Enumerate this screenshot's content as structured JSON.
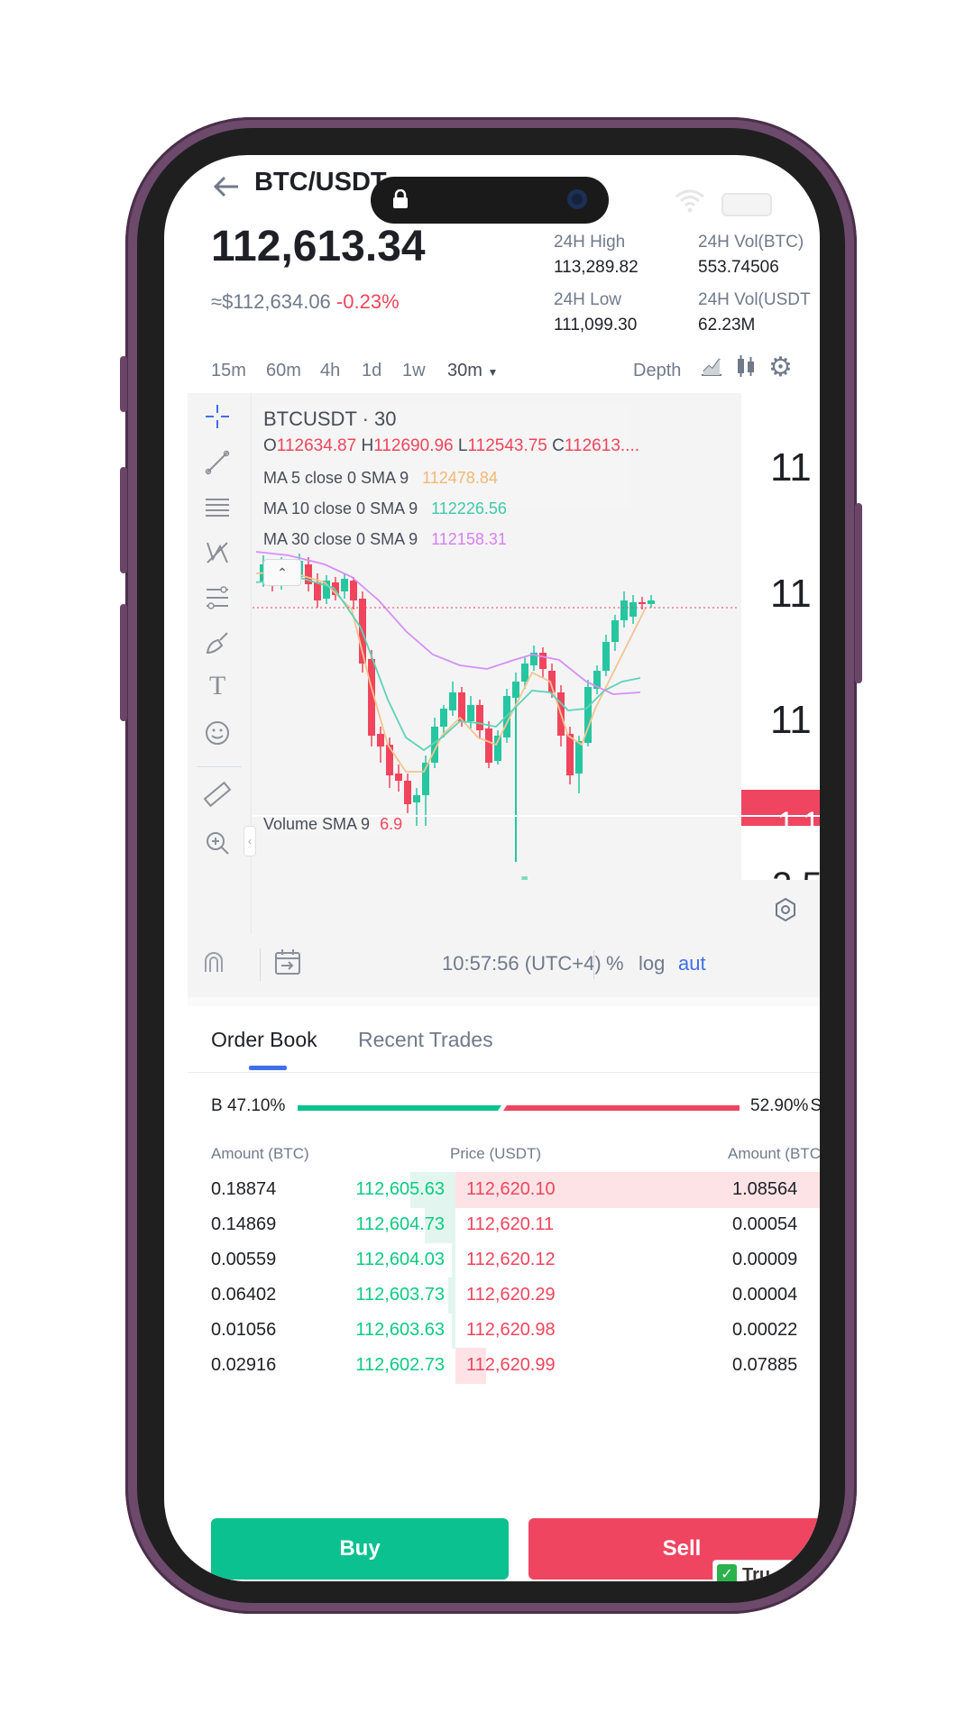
{
  "header": {
    "pair": "BTC/USDT",
    "last_price": "112,613.34",
    "usd_equiv": "≈$112,634.06",
    "change_pct": "-0.23%",
    "high_label": "24H High",
    "high_value": "113,289.82",
    "vol_btc_label": "24H Vol(BTC)",
    "vol_btc_value": "553.74506",
    "low_label": "24H Low",
    "low_value": "111,099.30",
    "vol_usdt_label": "24H Vol(USDT",
    "vol_usdt_value": "62.23M"
  },
  "timeframes": [
    "15m",
    "60m",
    "4h",
    "1d",
    "1w",
    "30m"
  ],
  "depth_label": "Depth",
  "chart": {
    "symbol_line": "BTCUSDT · 30",
    "ohlc": {
      "o_label": "O",
      "o": "112634.87",
      "h_label": "H",
      "h": "112690.96",
      "l_label": "L",
      "l": "112543.75",
      "c_label": "C",
      "c": "112613...."
    },
    "ma5_label": "MA 5 close 0 SMA 9",
    "ma5_value": "112478.84",
    "ma10_label": "MA 10 close 0 SMA 9",
    "ma10_value": "112226.56",
    "ma30_label": "MA 30 close 0 SMA 9",
    "ma30_value": "112158.31",
    "volume_label": "Volume SMA 9",
    "volume_value": "6.9",
    "scale_labels": [
      "11",
      "11",
      "11"
    ],
    "scale_last_price": "1 1",
    "volume_scale": "2 5",
    "time": "10:57:56 (UTC+4)",
    "pct_toggle": "%",
    "log_toggle": "log",
    "auto_toggle": "aut",
    "colors": {
      "up": "#26c6a0",
      "down": "#f0455c",
      "ma5": "#f5c48c",
      "ma10": "#5ed3b5",
      "ma30": "#d68ff5"
    }
  },
  "tabs": {
    "order_book": "Order Book",
    "recent_trades": "Recent Trades"
  },
  "ratio": {
    "buy": "B 47.10%",
    "sell": "52.90%",
    "sell_letter": "S",
    "buy_fraction": 0.471
  },
  "orderbook": {
    "headers": {
      "left": "Amount (BTC)",
      "center": "Price (USDT)",
      "right": "Amount (BTC"
    },
    "rows": [
      {
        "bid_amt": "0.18874",
        "bid_price": "112,605.63",
        "ask_price": "112,620.10",
        "ask_amt": "1.08564"
      },
      {
        "bid_amt": "0.14869",
        "bid_price": "112,604.73",
        "ask_price": "112,620.11",
        "ask_amt": "0.00054"
      },
      {
        "bid_amt": "0.00559",
        "bid_price": "112,604.03",
        "ask_price": "112,620.12",
        "ask_amt": "0.00009"
      },
      {
        "bid_amt": "0.06402",
        "bid_price": "112,603.73",
        "ask_price": "112,620.29",
        "ask_amt": "0.00004"
      },
      {
        "bid_amt": "0.01056",
        "bid_price": "112,603.63",
        "ask_price": "112,620.98",
        "ask_amt": "0.00022"
      },
      {
        "bid_amt": "0.02916",
        "bid_price": "112,602.73",
        "ask_price": "112,620.99",
        "ask_amt": "0.07885"
      }
    ]
  },
  "actions": {
    "buy": "Buy",
    "sell": "Sell",
    "badge": "Tru"
  }
}
